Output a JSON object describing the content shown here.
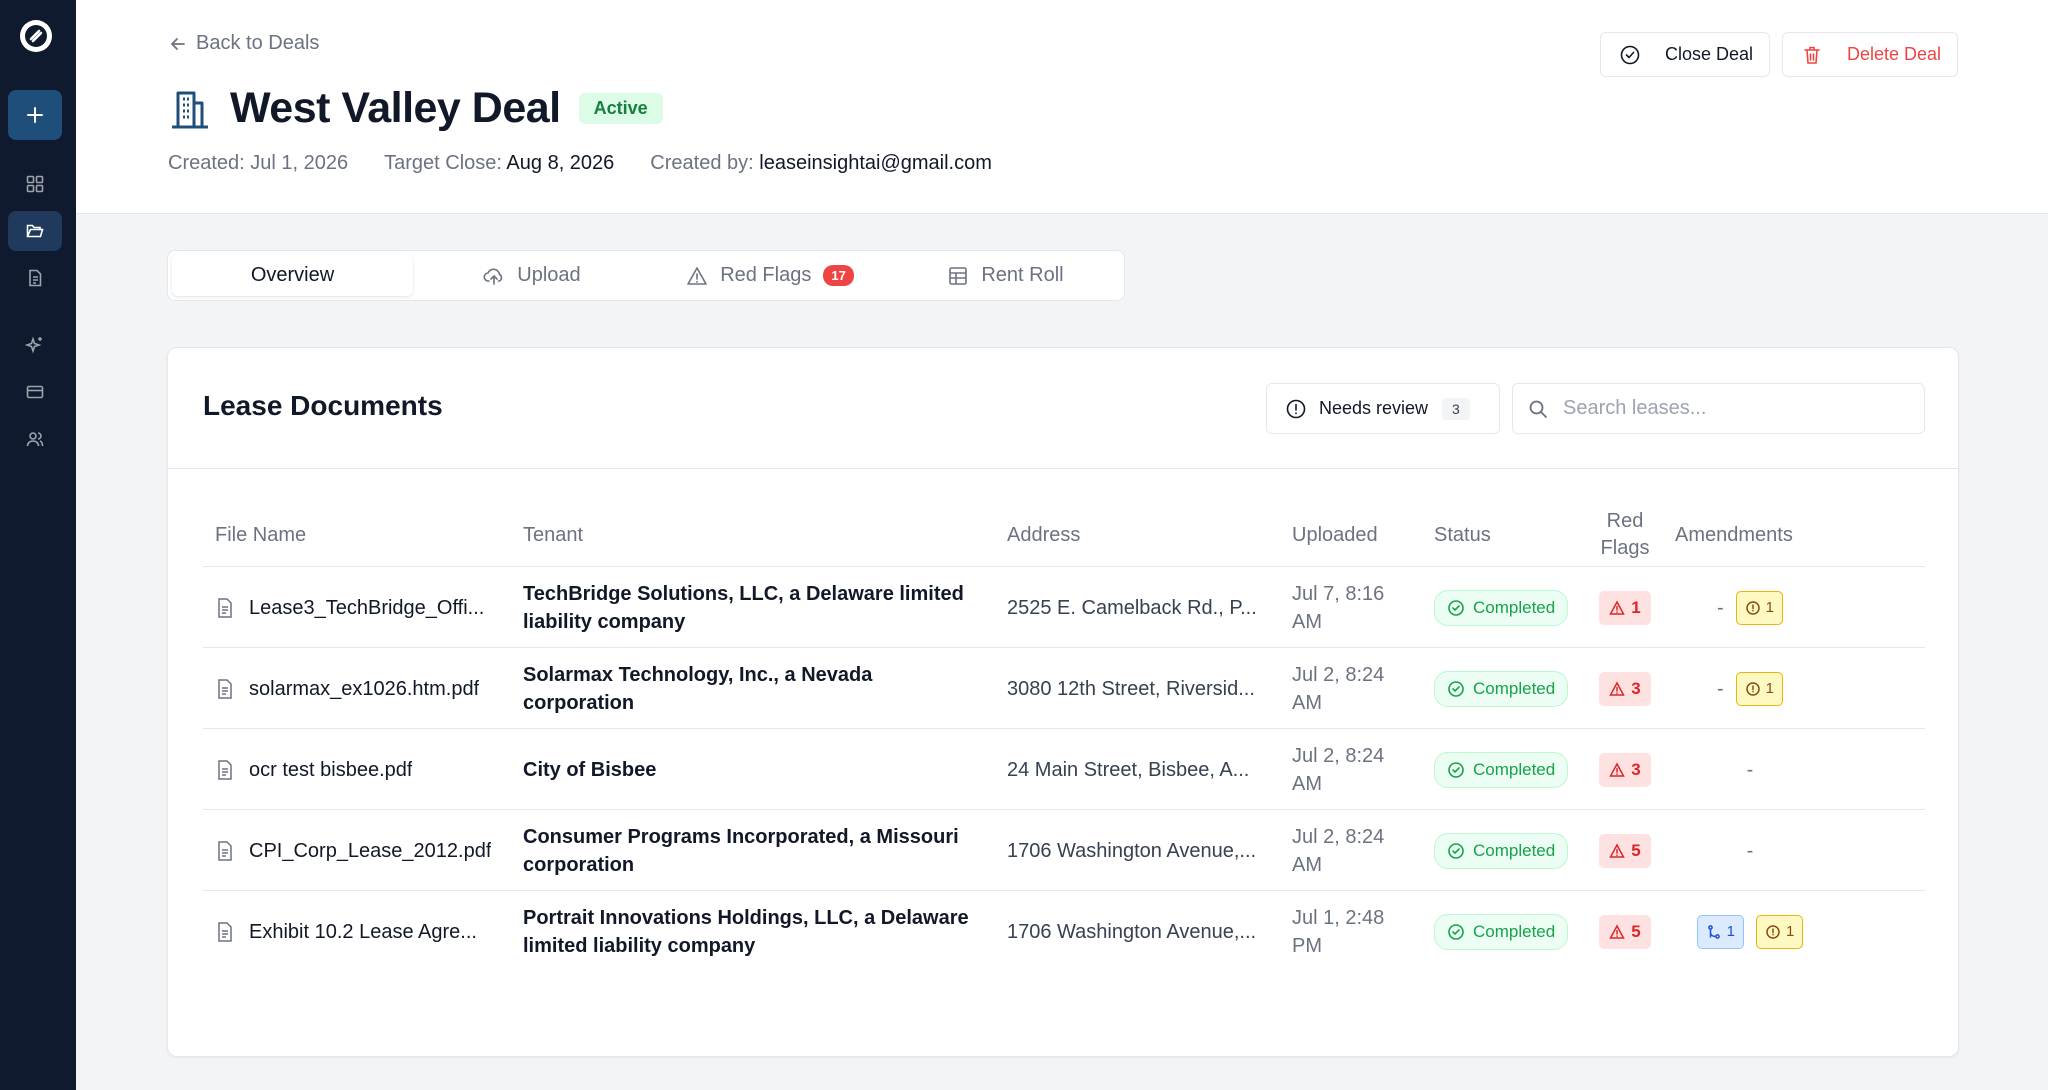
{
  "sidebar": {
    "items": [
      {
        "icon": "dashboard-icon"
      },
      {
        "icon": "folder-icon",
        "active": true
      },
      {
        "icon": "document-icon"
      },
      {
        "icon": "sparkles-icon"
      },
      {
        "icon": "credit-card-icon"
      },
      {
        "icon": "users-icon"
      }
    ]
  },
  "header": {
    "back_label": "Back to Deals",
    "title": "West Valley Deal",
    "status": "Active",
    "created_label": "Created: Jul 1, 2026",
    "target_label": "Target Close:",
    "target_value": "Aug 8, 2026",
    "created_by_label": "Created by:",
    "created_by_value": "leaseinsightai@gmail.com",
    "close_button": "Close Deal",
    "delete_button": "Delete Deal"
  },
  "tabs": [
    {
      "label": "Overview",
      "active": true
    },
    {
      "label": "Upload"
    },
    {
      "label": "Red Flags",
      "count": "17"
    },
    {
      "label": "Rent Roll"
    }
  ],
  "lease_documents": {
    "title": "Lease Documents",
    "needs_review_label": "Needs review",
    "needs_review_count": "3",
    "search_placeholder": "Search leases...",
    "columns": {
      "file_name": "File Name",
      "tenant": "Tenant",
      "address": "Address",
      "uploaded": "Uploaded",
      "status": "Status",
      "red_flags_1": "Red",
      "red_flags_2": "Flags",
      "amendments": "Amendments"
    },
    "rows": [
      {
        "file": "Lease3_TechBridge_Offi...",
        "tenant": "TechBridge Solutions, LLC, a Delaware limited liability company",
        "address": "2525 E. Camelback Rd., P...",
        "uploaded": "Jul 7, 8:16 AM",
        "status": "Completed",
        "flags": "1",
        "amend_dash": "-",
        "amend_warn": "1"
      },
      {
        "file": "solarmax_ex1026.htm.pdf",
        "tenant": "Solarmax Technology, Inc., a Nevada corporation",
        "address": "3080 12th Street, Riversid...",
        "uploaded": "Jul 2, 8:24 AM",
        "status": "Completed",
        "flags": "3",
        "amend_dash": "-",
        "amend_warn": "1"
      },
      {
        "file": "ocr test bisbee.pdf",
        "tenant": "City of Bisbee",
        "address": "24 Main Street, Bisbee, A...",
        "uploaded": "Jul 2, 8:24 AM",
        "status": "Completed",
        "flags": "3",
        "amend_dash": "-"
      },
      {
        "file": "CPI_Corp_Lease_2012.pdf",
        "tenant": "Consumer Programs Incorporated, a Missouri corporation",
        "address": "1706 Washington Avenue,...",
        "uploaded": "Jul 2, 8:24 AM",
        "status": "Completed",
        "flags": "5",
        "amend_dash": "-"
      },
      {
        "file": "Exhibit 10.2 Lease Agre...",
        "tenant": "Portrait Innovations Holdings, LLC, a Delaware limited liability company",
        "address": "1706 Washington Avenue,...",
        "uploaded": "Jul 1, 2:48 PM",
        "status": "Completed",
        "flags": "5",
        "amend_branch": "1",
        "amend_warn": "1"
      }
    ]
  },
  "colors": {
    "sidebar_bg": "#0f1a2e",
    "accent": "#1f4e7a",
    "success": "#16a34a",
    "danger": "#ef4444",
    "warning": "#eab308"
  }
}
